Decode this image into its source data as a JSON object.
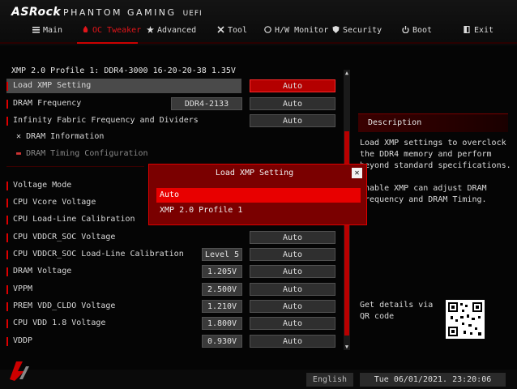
{
  "brand": {
    "logo": "ASRock",
    "subtitle": "PHANTOM GAMING",
    "uefi": "UEFI"
  },
  "nav": [
    {
      "label": "Main",
      "icon": "list-icon"
    },
    {
      "label": "OC Tweaker",
      "icon": "flame-icon",
      "active": true
    },
    {
      "label": "Advanced",
      "icon": "star-icon"
    },
    {
      "label": "Tool",
      "icon": "tools-icon"
    },
    {
      "label": "H/W Monitor",
      "icon": "monitor-icon"
    },
    {
      "label": "Security",
      "icon": "shield-icon"
    },
    {
      "label": "Boot",
      "icon": "power-icon"
    },
    {
      "label": "Exit",
      "icon": "exit-icon"
    }
  ],
  "profile_line": "XMP 2.0 Profile 1: DDR4-3000 16-20-20-38 1.35V",
  "settings": [
    {
      "label": "Load XMP Setting",
      "value": "Auto"
    },
    {
      "label": "DRAM Frequency",
      "current": "DDR4-2133",
      "value": "Auto"
    },
    {
      "label": "Infinity Fabric Frequency and Dividers",
      "value": "Auto"
    },
    {
      "label": "DRAM Information"
    },
    {
      "label": "DRAM Timing Configuration"
    },
    {
      "label": "Voltage Mode"
    },
    {
      "label": "CPU Vcore Voltage"
    },
    {
      "label": "CPU Load-Line Calibration"
    },
    {
      "label": "CPU VDDCR_SOC Voltage",
      "value": "Auto"
    },
    {
      "label": "CPU VDDCR_SOC Load-Line Calibration",
      "current": "Level 5",
      "value": "Auto"
    },
    {
      "label": "DRAM Voltage",
      "current": "1.205V",
      "value": "Auto"
    },
    {
      "label": "VPPM",
      "current": "2.500V",
      "value": "Auto"
    },
    {
      "label": "PREM VDD_CLDO Voltage",
      "current": "1.210V",
      "value": "Auto"
    },
    {
      "label": "CPU VDD 1.8 Voltage",
      "current": "1.800V",
      "value": "Auto"
    },
    {
      "label": "VDDP",
      "current": "0.930V",
      "value": "Auto"
    }
  ],
  "description": {
    "title": "Description",
    "p1": "Load XMP settings to overclock the DDR4 memory and perform beyond standard specifications.",
    "p2": "Enable XMP can adjust DRAM frequency and DRAM Timing.",
    "qr_text": "Get details via QR code"
  },
  "popup": {
    "title": "Load XMP Setting",
    "options": [
      "Auto",
      "XMP 2.0 Profile 1"
    ],
    "selected": "Auto"
  },
  "footer": {
    "language": "English",
    "datetime": "Tue 06/01/2021. 23:20:06"
  },
  "colors": {
    "accent": "#d00000",
    "selected_option": "#e80000",
    "popup_bg": "#7a0000"
  }
}
